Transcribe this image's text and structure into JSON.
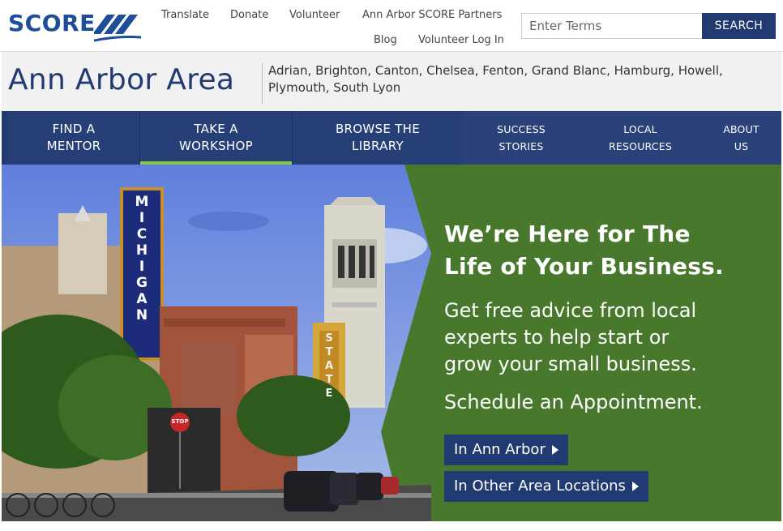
{
  "header": {
    "logo_text": "SCORE",
    "links": {
      "translate": "Translate",
      "donate": "Donate",
      "volunteer": "Volunteer",
      "partners": "Ann Arbor SCORE Partners",
      "blog": "Blog",
      "login": "Volunteer Log In"
    },
    "search": {
      "placeholder": "Enter Terms",
      "button": "SEARCH"
    }
  },
  "location": {
    "title": "Ann Arbor Area",
    "areas": "Adrian, Brighton, Canton, Chelsea, Fenton, Grand Blanc, Hamburg, Howell, Plymouth, South Lyon"
  },
  "nav": {
    "mentor": [
      "FIND A",
      "MENTOR"
    ],
    "workshop": [
      "TAKE A",
      "WORKSHOP"
    ],
    "library": [
      "BROWSE THE",
      "LIBRARY"
    ],
    "success": [
      "SUCCESS",
      "STORIES"
    ],
    "resources": [
      "LOCAL",
      "RESOURCES"
    ],
    "about": [
      "ABOUT",
      "US"
    ]
  },
  "hero": {
    "headline": [
      "We’re Here for The",
      "Life of Your Business."
    ],
    "subline": [
      "Get free advice from local",
      "experts to help start or",
      "grow your small business."
    ],
    "appointment": "Schedule an Appointment.",
    "cta_ann_arbor": "In Ann Arbor",
    "cta_other": "In Other Area Locations",
    "photo_signs": {
      "michigan": "MICHIGAN",
      "state": "STATE",
      "stop": "STOP"
    }
  },
  "colors": {
    "brand_blue": "#213b72",
    "hero_green": "#48782b",
    "accent_green": "#8cc63f"
  }
}
